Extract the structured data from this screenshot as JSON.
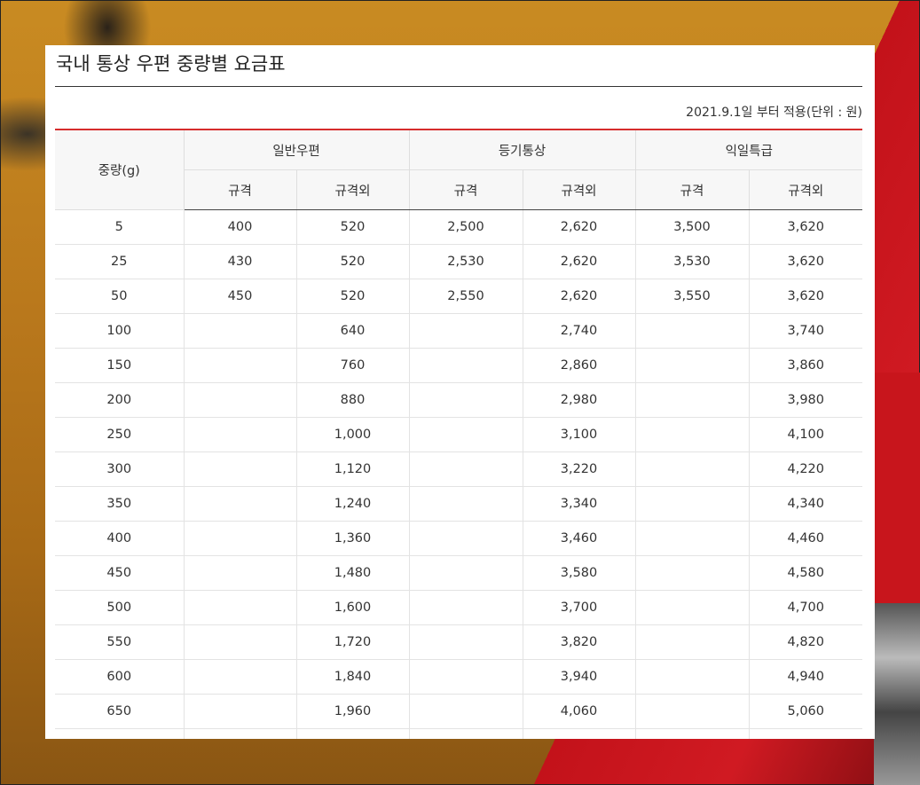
{
  "title": "국내 통상 우편 중량별 요금표",
  "note": "2021.9.1일 부터 적용(단위 : 원)",
  "headers": {
    "weight": "중량(g)",
    "groups": [
      "일반우편",
      "등기통상",
      "익일특급"
    ],
    "sub": [
      "규격",
      "규격외",
      "규격",
      "규격외",
      "규격",
      "규격외"
    ]
  },
  "rows": [
    [
      "5",
      "400",
      "520",
      "2,500",
      "2,620",
      "3,500",
      "3,620"
    ],
    [
      "25",
      "430",
      "520",
      "2,530",
      "2,620",
      "3,530",
      "3,620"
    ],
    [
      "50",
      "450",
      "520",
      "2,550",
      "2,620",
      "3,550",
      "3,620"
    ],
    [
      "100",
      "",
      "640",
      "",
      "2,740",
      "",
      "3,740"
    ],
    [
      "150",
      "",
      "760",
      "",
      "2,860",
      "",
      "3,860"
    ],
    [
      "200",
      "",
      "880",
      "",
      "2,980",
      "",
      "3,980"
    ],
    [
      "250",
      "",
      "1,000",
      "",
      "3,100",
      "",
      "4,100"
    ],
    [
      "300",
      "",
      "1,120",
      "",
      "3,220",
      "",
      "4,220"
    ],
    [
      "350",
      "",
      "1,240",
      "",
      "3,340",
      "",
      "4,340"
    ],
    [
      "400",
      "",
      "1,360",
      "",
      "3,460",
      "",
      "4,460"
    ],
    [
      "450",
      "",
      "1,480",
      "",
      "3,580",
      "",
      "4,580"
    ],
    [
      "500",
      "",
      "1,600",
      "",
      "3,700",
      "",
      "4,700"
    ],
    [
      "550",
      "",
      "1,720",
      "",
      "3,820",
      "",
      "4,820"
    ],
    [
      "600",
      "",
      "1,840",
      "",
      "3,940",
      "",
      "4,940"
    ],
    [
      "650",
      "",
      "1,960",
      "",
      "4,060",
      "",
      "5,060"
    ],
    [
      "",
      "",
      "",
      "",
      "",
      "",
      ""
    ]
  ],
  "colors": {
    "accent_rule": "#d62c2c",
    "header_bg": "#f7f7f7"
  }
}
